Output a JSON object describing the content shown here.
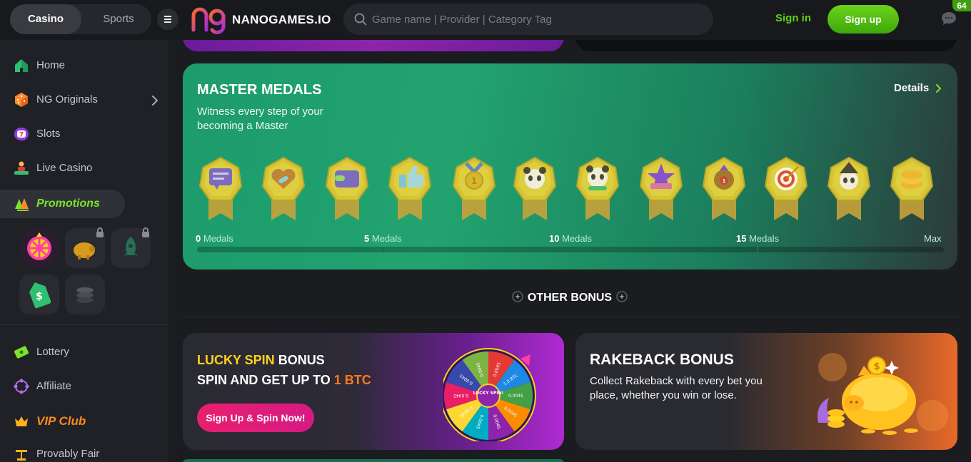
{
  "header": {
    "tabs": [
      {
        "label": "Casino",
        "active": true
      },
      {
        "label": "Sports",
        "active": false
      }
    ],
    "logo_text": "NANOGAMES.IO",
    "search_placeholder": "Game name | Provider | Category Tag",
    "signin_label": "Sign in",
    "signup_label": "Sign up",
    "chat_badge": "64"
  },
  "sidebar": {
    "items": [
      {
        "label": "Home",
        "icon": "home-icon"
      },
      {
        "label": "NG Originals",
        "icon": "dice-icon"
      },
      {
        "label": "Slots",
        "icon": "slots-icon"
      },
      {
        "label": "Live Casino",
        "icon": "live-casino-icon"
      },
      {
        "label": "Promotions",
        "icon": "promotions-icon",
        "active": true
      },
      {
        "label": "Lottery",
        "icon": "lottery-icon"
      },
      {
        "label": "Affiliate",
        "icon": "affiliate-icon"
      },
      {
        "label": "VIP Club",
        "icon": "crown-icon"
      },
      {
        "label": "Provably Fair",
        "icon": "scales-icon"
      }
    ],
    "promo_icons": [
      "lucky-wheel-icon",
      "piggy-bank-icon",
      "rocket-icon",
      "price-tag-icon",
      "coin-stack-icon"
    ]
  },
  "medals": {
    "title": "MASTER MEDALS",
    "subtitle": "Witness every step of your becoming a Master",
    "details_label": "Details",
    "badges": [
      "chat-medal",
      "heart-medal",
      "wallet-medal",
      "thumbs-up-medal",
      "ribbon-medal",
      "panda-medal",
      "panda-green-medal",
      "star-medal",
      "rank-medal",
      "target-medal",
      "wizard-panda-medal",
      "coins-medal"
    ],
    "milestones": [
      {
        "num": "0",
        "unit": "Medals"
      },
      {
        "num": "5",
        "unit": "Medals"
      },
      {
        "num": "10",
        "unit": "Medals"
      },
      {
        "num": "15",
        "unit": "Medals"
      },
      {
        "num": "",
        "unit": "Max"
      }
    ],
    "progress": 0
  },
  "other_bonus": {
    "title": "OTHER BONUS"
  },
  "lucky_spin": {
    "line1_highlight": "LUCKY SPIN",
    "line1_rest": " BONUS",
    "line2_rest": "SPIN AND GET UP TO ",
    "line2_highlight": "1 BTC",
    "button_label": "Sign Up & Spin Now!",
    "wheel_center": "LUCKY SPIN!",
    "wheel_values": [
      "0.0045",
      "1.0 BTC",
      "0.0045",
      "0.0045",
      "0.0045",
      "0.0045",
      "0.0045",
      "0.0045",
      "0.0045",
      "0.0045"
    ]
  },
  "rakeback": {
    "title": "RAKEBACK BONUS",
    "subtitle": "Collect Rakeback with every bet you place, whether you win or lose."
  }
}
